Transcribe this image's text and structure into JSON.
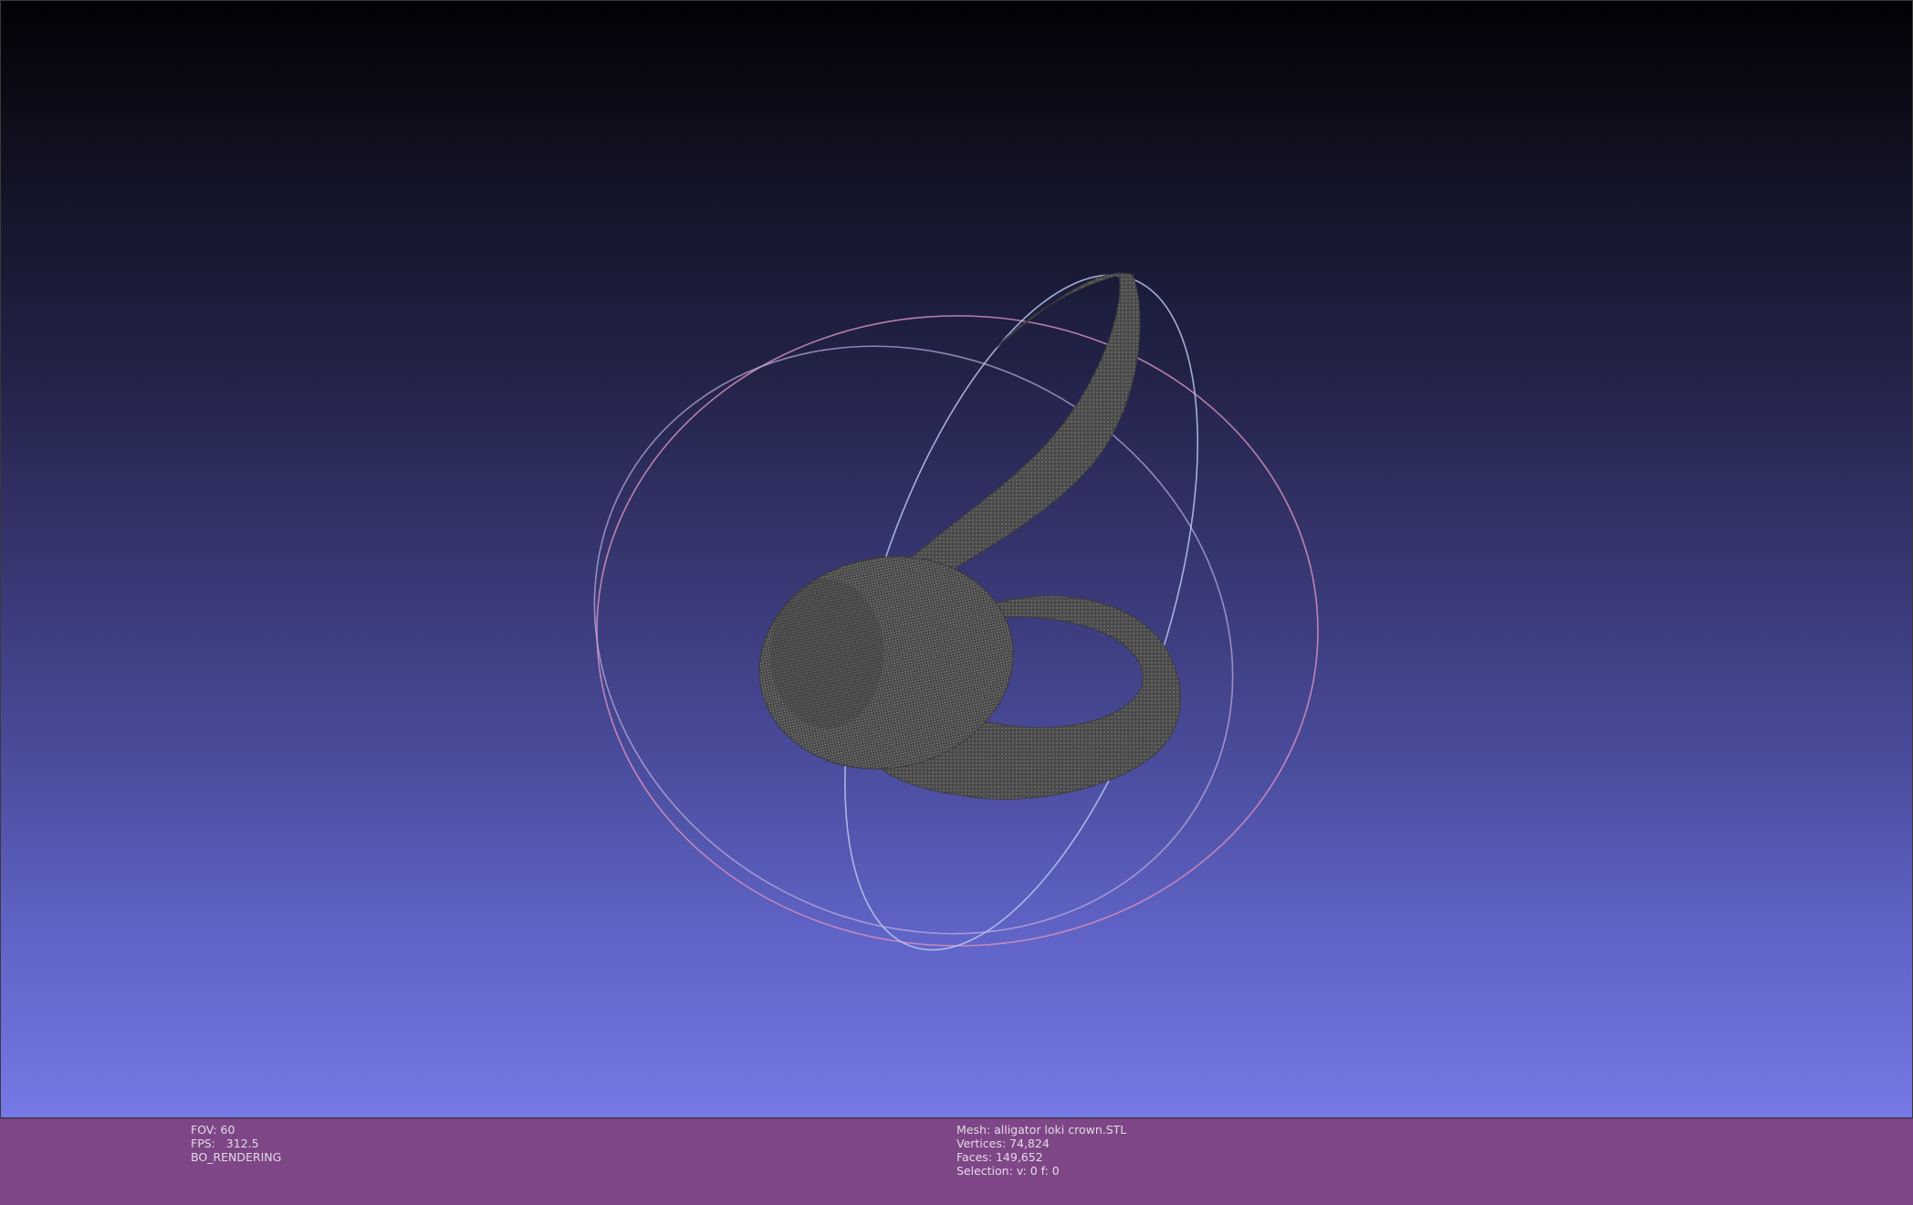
{
  "viewport": {
    "background_top": "#020205",
    "background_bottom": "#7678e6",
    "mesh_color": "#4a4a4a",
    "trackball_colors": [
      "#d98ab8",
      "#b9aee0",
      "#a9c8ea"
    ]
  },
  "status_bar": {
    "color": "#7e4686",
    "left": {
      "fov": "FOV: 60",
      "fps": "FPS:   312.5",
      "mode": "BO_RENDERING"
    },
    "right": {
      "mesh": "Mesh: alligator loki crown.STL",
      "vertices": "Vertices: 74,824",
      "faces": "Faces: 149,652",
      "selection": "Selection: v: 0 f: 0"
    }
  }
}
